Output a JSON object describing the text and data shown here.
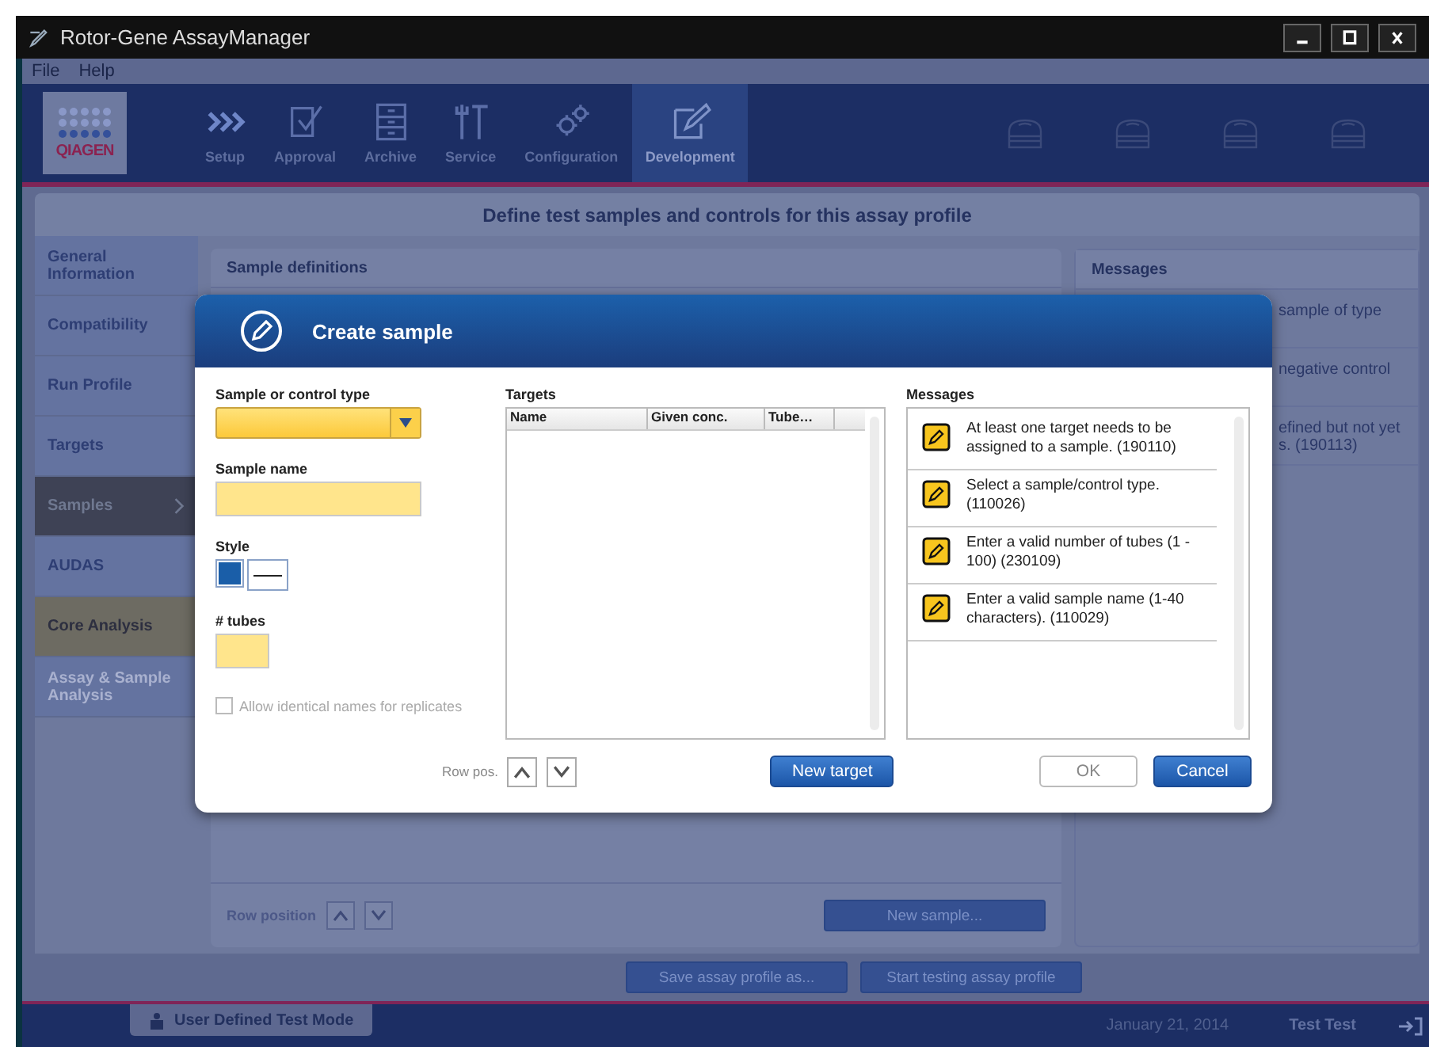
{
  "window": {
    "title": "Rotor-Gene AssayManager"
  },
  "menu": [
    "File",
    "Help"
  ],
  "logo": {
    "text": "QIAGEN"
  },
  "nav": [
    {
      "label": "Setup",
      "selected": false
    },
    {
      "label": "Approval",
      "selected": false
    },
    {
      "label": "Archive",
      "selected": false
    },
    {
      "label": "Service",
      "selected": false
    },
    {
      "label": "Configuration",
      "selected": false
    },
    {
      "label": "Development",
      "selected": true
    }
  ],
  "page_title": "Define test samples and controls for this assay profile",
  "sidebar": {
    "items": [
      {
        "label": "General Information",
        "selected": false,
        "highlighted": false,
        "disabled": false
      },
      {
        "label": "Compatibility",
        "selected": false,
        "highlighted": false,
        "disabled": false
      },
      {
        "label": "Run Profile",
        "selected": false,
        "highlighted": false,
        "disabled": false
      },
      {
        "label": "Targets",
        "selected": false,
        "highlighted": false,
        "disabled": false
      },
      {
        "label": "Samples",
        "selected": true,
        "highlighted": false,
        "disabled": false
      },
      {
        "label": "AUDAS",
        "selected": false,
        "highlighted": false,
        "disabled": false
      },
      {
        "label": "Core Analysis",
        "selected": false,
        "highlighted": true,
        "disabled": false
      },
      {
        "label": "Assay & Sample Analysis",
        "selected": false,
        "highlighted": false,
        "disabled": true
      }
    ]
  },
  "sample_definitions": {
    "title": "Sample definitions",
    "row_position_label": "Row position",
    "new_sample_button": "New sample..."
  },
  "messages_panel": {
    "title": "Messages",
    "messages": [
      [
        "sample of type"
      ],
      [
        "negative control"
      ],
      [
        "efined but not yet",
        "s. (190113)"
      ]
    ]
  },
  "footer_buttons": [
    "Save assay profile as...",
    "Start testing assay profile"
  ],
  "status_bar": {
    "mode": "User Defined Test Mode",
    "date": "January 21, 2014",
    "user": "Test Test"
  },
  "dialog": {
    "title": "Create sample",
    "type_label": "Sample or control type",
    "name_label": "Sample name",
    "style_label": "Style",
    "style_options": [
      {
        "kind": "fill"
      },
      {
        "kind": "line"
      }
    ],
    "tubes_label": "# tubes",
    "replicates_checkbox": {
      "label": "Allow identical names for replicates",
      "checked": false,
      "disabled": true
    },
    "targets": {
      "label": "Targets",
      "columns": [
        "Name",
        "Given conc.",
        "Tube…"
      ]
    },
    "row_pos_label": "Row pos.",
    "new_target_button": "New target",
    "messages": {
      "label": "Messages",
      "items": [
        "At least one target needs to be assigned to a sample. (190110)",
        "Select a sample/control type. (110026)",
        "Enter a valid number of tubes (1 - 100) (230109)",
        "Enter a valid sample name (1-40 characters). (110029)"
      ]
    },
    "buttons": [
      {
        "label": "OK",
        "kind": "secondary"
      },
      {
        "label": "Cancel",
        "kind": "primary"
      }
    ]
  }
}
